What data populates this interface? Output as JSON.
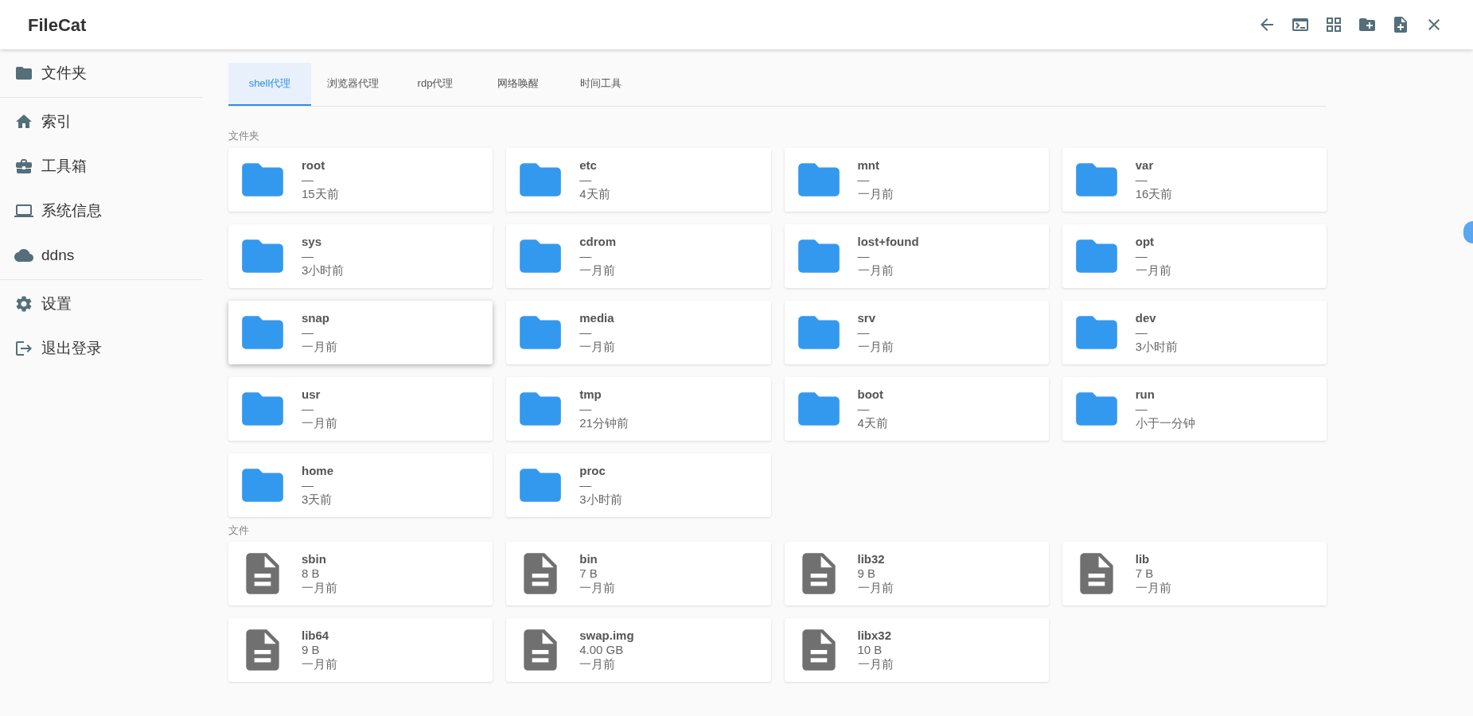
{
  "app_title": "FileCat",
  "sidebar": {
    "groups": [
      [
        {
          "label": "文件夹"
        }
      ],
      [
        {
          "label": "索引"
        },
        {
          "label": "工具箱"
        },
        {
          "label": "系统信息"
        },
        {
          "label": "ddns"
        }
      ],
      [
        {
          "label": "设置"
        },
        {
          "label": "退出登录"
        }
      ]
    ]
  },
  "tabs": [
    {
      "label": "shell代理",
      "selected": true
    },
    {
      "label": "浏览器代理",
      "selected": false
    },
    {
      "label": "rdp代理",
      "selected": false
    },
    {
      "label": "网络唤醒",
      "selected": false
    },
    {
      "label": "时间工具",
      "selected": false
    }
  ],
  "sections": [
    {
      "title": "文件夹",
      "kind": "folder",
      "items": [
        {
          "name": "root",
          "size": "—",
          "time": "15天前",
          "hovered": false
        },
        {
          "name": "etc",
          "size": "—",
          "time": "4天前",
          "hovered": false
        },
        {
          "name": "mnt",
          "size": "—",
          "time": "一月前",
          "hovered": false
        },
        {
          "name": "var",
          "size": "—",
          "time": "16天前",
          "hovered": false
        },
        {
          "name": "sys",
          "size": "—",
          "time": "3小时前",
          "hovered": false
        },
        {
          "name": "cdrom",
          "size": "—",
          "time": "一月前",
          "hovered": false
        },
        {
          "name": "lost+found",
          "size": "—",
          "time": "一月前",
          "hovered": false
        },
        {
          "name": "opt",
          "size": "—",
          "time": "一月前",
          "hovered": false
        },
        {
          "name": "snap",
          "size": "—",
          "time": "一月前",
          "hovered": true
        },
        {
          "name": "media",
          "size": "—",
          "time": "一月前",
          "hovered": false
        },
        {
          "name": "srv",
          "size": "—",
          "time": "一月前",
          "hovered": false
        },
        {
          "name": "dev",
          "size": "—",
          "time": "3小时前",
          "hovered": false
        },
        {
          "name": "usr",
          "size": "—",
          "time": "一月前",
          "hovered": false
        },
        {
          "name": "tmp",
          "size": "—",
          "time": "21分钟前",
          "hovered": false
        },
        {
          "name": "boot",
          "size": "—",
          "time": "4天前",
          "hovered": false
        },
        {
          "name": "run",
          "size": "—",
          "time": "小于一分钟",
          "hovered": false
        },
        {
          "name": "home",
          "size": "—",
          "time": "3天前",
          "hovered": false
        },
        {
          "name": "proc",
          "size": "—",
          "time": "3小时前",
          "hovered": false
        }
      ]
    },
    {
      "title": "文件",
      "kind": "file",
      "items": [
        {
          "name": "sbin",
          "size": "8 B",
          "time": "一月前",
          "hovered": false
        },
        {
          "name": "bin",
          "size": "7 B",
          "time": "一月前",
          "hovered": false
        },
        {
          "name": "lib32",
          "size": "9 B",
          "time": "一月前",
          "hovered": false
        },
        {
          "name": "lib",
          "size": "7 B",
          "time": "一月前",
          "hovered": false
        },
        {
          "name": "lib64",
          "size": "9 B",
          "time": "一月前",
          "hovered": false
        },
        {
          "name": "swap.img",
          "size": "4.00 GB",
          "time": "一月前",
          "hovered": false
        },
        {
          "name": "libx32",
          "size": "10 B",
          "time": "一月前",
          "hovered": false
        }
      ]
    }
  ]
}
